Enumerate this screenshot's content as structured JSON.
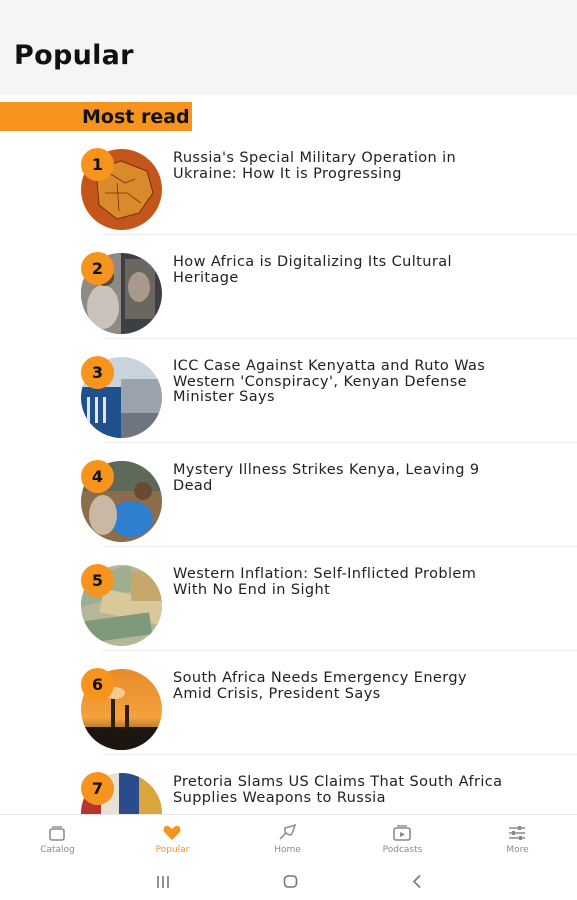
{
  "header": {
    "title": "Popular"
  },
  "section": {
    "title": "Most read"
  },
  "articles": [
    {
      "rank": "1",
      "headline": "Russia's Special Military Operation in Ukraine: How It is Progressing",
      "thumb_icon": "map-thumbnail"
    },
    {
      "rank": "2",
      "headline": "How Africa is Digitalizing Its Cultural Heritage",
      "thumb_icon": "statue-thumbnail"
    },
    {
      "rank": "3",
      "headline": "ICC Case Against Kenyatta and Ruto Was Western 'Conspiracy', Kenyan Defense Minister Says",
      "thumb_icon": "building-thumbnail"
    },
    {
      "rank": "4",
      "headline": "Mystery Illness Strikes Kenya, Leaving 9 Dead",
      "thumb_icon": "medical-thumbnail"
    },
    {
      "rank": "5",
      "headline": "Western Inflation: Self-Inflicted Problem With No End in Sight",
      "thumb_icon": "money-thumbnail"
    },
    {
      "rank": "6",
      "headline": "South Africa Needs Emergency Energy Amid Crisis, President Says",
      "thumb_icon": "power-plant-thumbnail"
    },
    {
      "rank": "7",
      "headline": "Pretoria Slams US Claims That South Africa Supplies Weapons to Russia",
      "thumb_icon": "flags-thumbnail"
    }
  ],
  "bottom_nav": {
    "items": [
      {
        "label": "Catalog",
        "icon": "catalog-icon",
        "active": false
      },
      {
        "label": "Popular",
        "icon": "heart-icon",
        "active": true
      },
      {
        "label": "Home",
        "icon": "home-icon",
        "active": false
      },
      {
        "label": "Podcasts",
        "icon": "podcasts-icon",
        "active": false
      },
      {
        "label": "More",
        "icon": "sliders-icon",
        "active": false
      }
    ]
  },
  "colors": {
    "accent": "#f7941d",
    "header_bg": "#f5f5f5",
    "inactive": "#8a8a8a"
  }
}
